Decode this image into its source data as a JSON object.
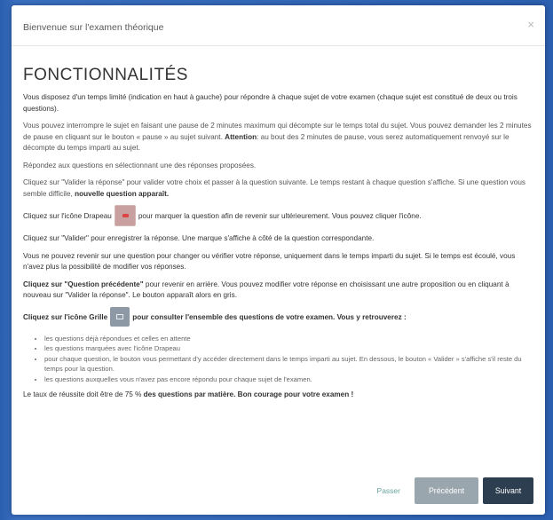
{
  "modal": {
    "title": "Bienvenue sur l'examen théorique",
    "close": "×"
  },
  "body": {
    "heading": "FONCTIONNALITÉS",
    "p1": "Vous disposez d'un temps limité (indication en haut à gauche) pour répondre à chaque sujet de votre examen (chaque sujet est constitué de deux ou trois questions).",
    "p2a": "Vous pouvez interrompre le sujet en faisant une pause de 2 minutes maximum qui décompte sur le temps total du sujet. Vous pouvez demander les 2 minutes de pause en cliquant sur le bouton « pause » au sujet suivant.",
    "p2b": "Attention",
    "p2c": ": au bout des 2 minutes de pause, vous serez automatiquement renvoyé sur le décompte du temps imparti au sujet.",
    "p3": "Répondez aux questions en sélectionnant une des réponses proposées.",
    "p4a": "Cliquez sur \"Valider la réponse\" pour valider votre choix et passer à la question suivante. Le temps restant à chaque question s'affiche. Si une question vous semble difficile, ",
    "p4b": "nouvelle question apparaît.",
    "p5a": "Cliquez sur l'icône Drapeau",
    "p5b": "pour marquer la question afin de revenir sur ultérieurement. Vous pouvez cliquer l'icône.",
    "p6": "Cliquez sur \"Valider\" pour enregistrer la réponse. Une marque s'affiche à côté de la question correspondante.",
    "p7a": "Vous ne pouvez revenir sur une question pour changer ou vérifier votre réponse, uniquement dans le temps imparti du sujet. Si le temps est écoulé, vous n'avez plus la possibilité de modifier vos réponses.",
    "p8a": "Cliquez sur \"Question précédente\"",
    "p8b": " pour revenir en arrière. Vous pouvez modifier votre réponse en choisissant une autre proposition ou en cliquant à nouveau sur \"Valider la réponse\". Le bouton apparaît alors en gris.",
    "p9a": "Cliquez sur l'icône Grille",
    "p9b": "pour consulter l'ensemble des questions de votre examen. Vous y retrouverez :",
    "list": [
      "les questions déjà répondues et celles en attente",
      "les questions marquées avec l'icône Drapeau",
      "pour chaque question, le bouton vous permettant d'y accéder directement dans le temps imparti au sujet. En dessous, le bouton « Valider » s'affiche s'il reste du temps pour la question.",
      "les questions auxquelles vous n'avez pas encore répondu pour chaque sujet de l'examen."
    ],
    "p10a": "Le taux de réussite doit être de 75 % ",
    "p10b": "des questions par matière. Bon courage pour votre examen !"
  },
  "footer": {
    "link": "Passer",
    "prev": "Précédent",
    "next": "Suivant"
  },
  "colors": {
    "backdrop": "#2e64b6",
    "prev_button": "#9aa6ad",
    "next_button": "#2d3e50",
    "link": "#6aa5a0"
  },
  "icons": [
    "close-icon",
    "flag-icon",
    "grid-icon"
  ]
}
